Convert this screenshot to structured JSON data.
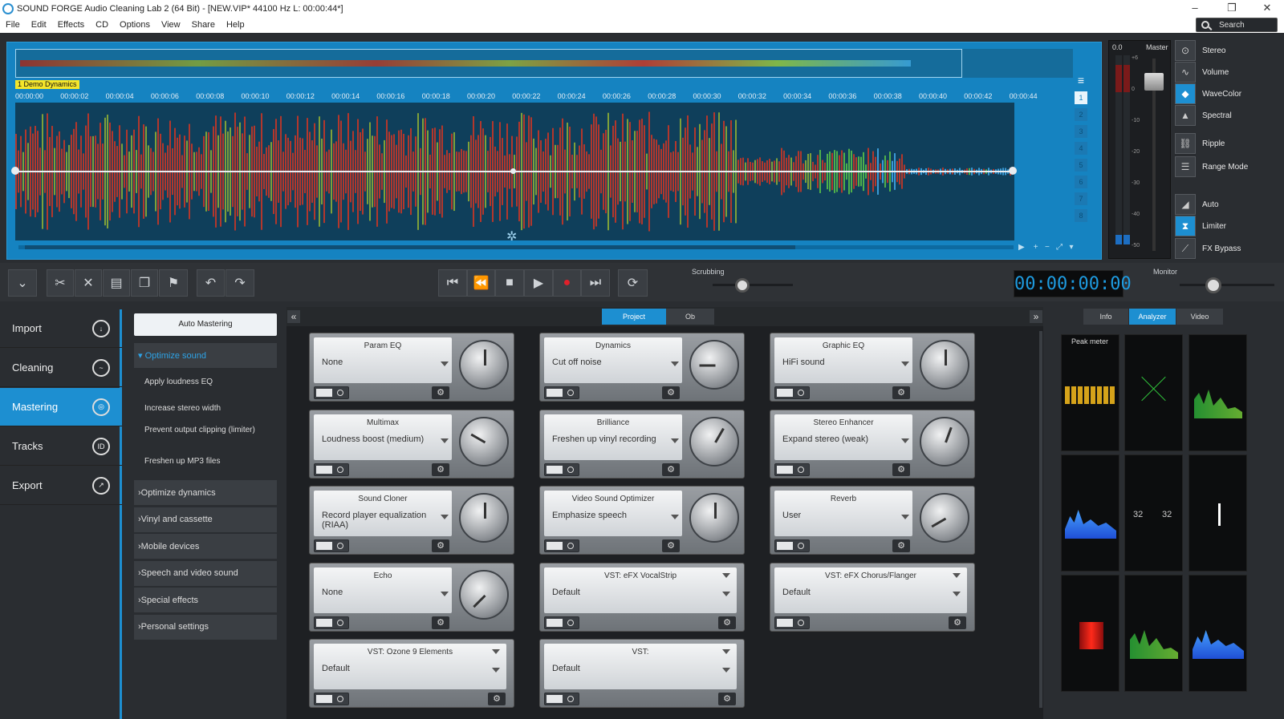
{
  "titlebar": {
    "title": "SOUND FORGE Audio Cleaning Lab 2 (64 Bit) - [NEW.VIP*   44100 Hz L: 00:00:44*]",
    "minimize": "–",
    "restore": "❐",
    "close": "✕"
  },
  "menu": [
    "File",
    "Edit",
    "Effects",
    "CD",
    "Options",
    "View",
    "Share",
    "Help"
  ],
  "search": {
    "label": "Search"
  },
  "track": {
    "label": "1 Demo Dynamics"
  },
  "ruler": [
    "00:00:00",
    "00:00:02",
    "00:00:04",
    "00:00:06",
    "00:00:08",
    "00:00:10",
    "00:00:12",
    "00:00:14",
    "00:00:16",
    "00:00:18",
    "00:00:20",
    "00:00:22",
    "00:00:24",
    "00:00:26",
    "00:00:28",
    "00:00:30",
    "00:00:32",
    "00:00:34",
    "00:00:36",
    "00:00:38",
    "00:00:40",
    "00:00:42",
    "00:00:44"
  ],
  "track_buttons": [
    "1",
    "2",
    "3",
    "4",
    "5",
    "6",
    "7",
    "8"
  ],
  "master": {
    "value": "0.0",
    "title": "Master",
    "scale": [
      "+6",
      "0",
      "-10",
      "-20",
      "-30",
      "-40",
      "-50"
    ]
  },
  "right_buttons": [
    {
      "label": "Stereo",
      "icon": "stereo-icon",
      "on": false
    },
    {
      "label": "Volume",
      "icon": "volume-icon",
      "on": false
    },
    {
      "label": "WaveColor",
      "icon": "wavecolor-icon",
      "on": true
    },
    {
      "label": "Spectral",
      "icon": "spectral-icon",
      "on": false
    },
    {
      "label": "Ripple",
      "icon": "ripple-icon",
      "on": false
    },
    {
      "label": "Range Mode",
      "icon": "range-mode-icon",
      "on": false
    },
    {
      "label": "Auto",
      "icon": "auto-icon",
      "on": false
    },
    {
      "label": "Limiter",
      "icon": "limiter-icon",
      "on": true
    },
    {
      "label": "FX Bypass",
      "icon": "fx-bypass-icon",
      "on": false
    }
  ],
  "transport": {
    "scrubbing": "Scrubbing",
    "timecode": "00:00:00:00",
    "monitor": "Monitor"
  },
  "nav": [
    {
      "label": "Import",
      "active": false,
      "icon": "import-icon"
    },
    {
      "label": "Cleaning",
      "active": false,
      "icon": "cleaning-icon"
    },
    {
      "label": "Mastering",
      "active": true,
      "icon": "mastering-icon"
    },
    {
      "label": "Tracks",
      "active": false,
      "icon": "tracks-icon"
    },
    {
      "label": "Export",
      "active": false,
      "icon": "export-icon"
    }
  ],
  "presets": {
    "auto_mastering": "Auto Mastering",
    "open_section": "Optimize sound",
    "sub_items": [
      "Apply loudness EQ",
      "Increase stereo width",
      "Prevent output clipping (limiter)",
      "Freshen up MP3 files"
    ],
    "sections": [
      "Optimize dynamics",
      "Vinyl and cassette",
      "Mobile devices",
      "Speech and video sound",
      "Special effects",
      "Personal settings"
    ]
  },
  "fxtabs": {
    "project": "Project",
    "object": "Ob"
  },
  "effects": [
    {
      "name": "Param EQ",
      "value": "None",
      "wide": false,
      "angle": 0
    },
    {
      "name": "Dynamics",
      "value": "Cut off noise",
      "wide": false,
      "angle": -90
    },
    {
      "name": "Graphic EQ",
      "value": "HiFi sound",
      "wide": false,
      "angle": 0
    },
    {
      "name": "Multimax",
      "value": "Loudness boost (medium)",
      "wide": false,
      "angle": -60
    },
    {
      "name": "Brilliance",
      "value": "Freshen up vinyl recording",
      "wide": false,
      "angle": 30
    },
    {
      "name": "Stereo Enhancer",
      "value": "Expand stereo (weak)",
      "wide": false,
      "angle": 20
    },
    {
      "name": "Sound Cloner",
      "value": "Record player equalization (RIAA)",
      "wide": false,
      "angle": 0
    },
    {
      "name": "Video Sound Optimizer",
      "value": "Emphasize speech",
      "wide": false,
      "angle": 0
    },
    {
      "name": "Reverb",
      "value": "User",
      "wide": false,
      "angle": -120
    },
    {
      "name": "Echo",
      "value": "None",
      "wide": false,
      "angle": -135
    },
    {
      "name": "VST: eFX VocalStrip",
      "value": "Default",
      "wide": true,
      "angle": 0
    },
    {
      "name": "VST: eFX Chorus/Flanger",
      "value": "Default",
      "wide": true,
      "angle": 0
    },
    {
      "name": "VST: Ozone 9 Elements",
      "value": "Default",
      "wide": true,
      "angle": 0
    },
    {
      "name": "VST:",
      "value": "Default",
      "wide": true,
      "angle": 0
    }
  ],
  "right_tabs": [
    "Info",
    "Analyzer",
    "Video"
  ],
  "analyzer": {
    "peak_label": "Peak meter",
    "num_left": "32",
    "num_right": "32"
  },
  "colors": {
    "accent": "#1d8fd1",
    "timecode": "#1e9be0",
    "track_label_bg": "#f5e62a"
  }
}
